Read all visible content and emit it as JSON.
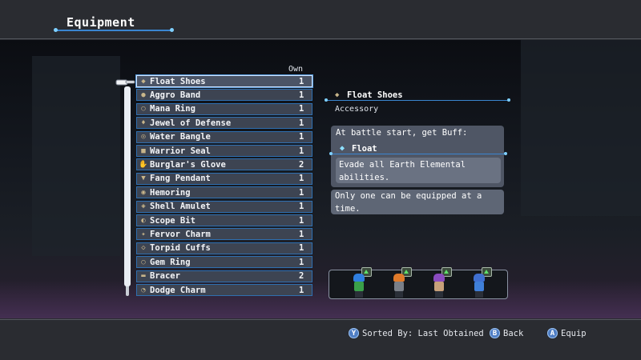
{
  "header": {
    "title": "Equipment"
  },
  "list": {
    "own_label": "Own",
    "items": [
      {
        "name": "Float Shoes",
        "count": "1",
        "icon": "shoe-icon",
        "glyph": "◆"
      },
      {
        "name": "Aggro Band",
        "count": "1",
        "icon": "band-icon",
        "glyph": "●"
      },
      {
        "name": "Mana Ring",
        "count": "1",
        "icon": "ring-icon",
        "glyph": "○"
      },
      {
        "name": "Jewel of Defense",
        "count": "1",
        "icon": "jewel-icon",
        "glyph": "♦"
      },
      {
        "name": "Water Bangle",
        "count": "1",
        "icon": "bangle-icon",
        "glyph": "◎"
      },
      {
        "name": "Warrior Seal",
        "count": "1",
        "icon": "seal-icon",
        "glyph": "■"
      },
      {
        "name": "Burglar's Glove",
        "count": "2",
        "icon": "glove-icon",
        "glyph": "✋"
      },
      {
        "name": "Fang Pendant",
        "count": "1",
        "icon": "pendant-icon",
        "glyph": "▼"
      },
      {
        "name": "Hemoring",
        "count": "1",
        "icon": "ring-icon",
        "glyph": "◉"
      },
      {
        "name": "Shell Amulet",
        "count": "1",
        "icon": "amulet-icon",
        "glyph": "◈"
      },
      {
        "name": "Scope Bit",
        "count": "1",
        "icon": "scope-icon",
        "glyph": "◐"
      },
      {
        "name": "Fervor Charm",
        "count": "1",
        "icon": "charm-icon",
        "glyph": "✦"
      },
      {
        "name": "Torpid Cuffs",
        "count": "1",
        "icon": "cuffs-icon",
        "glyph": "◇"
      },
      {
        "name": "Gem Ring",
        "count": "1",
        "icon": "ring-icon",
        "glyph": "○"
      },
      {
        "name": "Bracer",
        "count": "2",
        "icon": "bracer-icon",
        "glyph": "▬"
      },
      {
        "name": "Dodge Charm",
        "count": "1",
        "icon": "charm-icon",
        "glyph": "◔"
      }
    ],
    "selected_index": 0
  },
  "detail": {
    "name": "Float Shoes",
    "type": "Accessory",
    "effect_intro": "At battle start, get Buff:",
    "buff_name": "Float",
    "buff_desc": "Evade all Earth Elemental abilities.",
    "note": "Only one can be equipped at a time."
  },
  "party": [
    {
      "name": "member-1",
      "hair": "#2f7ee0",
      "body": "#3aa04a"
    },
    {
      "name": "member-2",
      "hair": "#e07a2a",
      "body": "#7a7f88"
    },
    {
      "name": "member-3",
      "hair": "#8a4bc0",
      "body": "#c7a07a"
    },
    {
      "name": "member-4",
      "hair": "#3f6fd0",
      "body": "#3f7fd8"
    }
  ],
  "footer": {
    "sort_button": "Y",
    "sort_label": "Sorted By: Last Obtained",
    "back_button": "B",
    "back_label": "Back",
    "equip_button": "A",
    "equip_label": "Equip"
  },
  "colors": {
    "accent": "#3a86d0",
    "item_bg": "#3d4452",
    "panel": "#5e6675"
  }
}
